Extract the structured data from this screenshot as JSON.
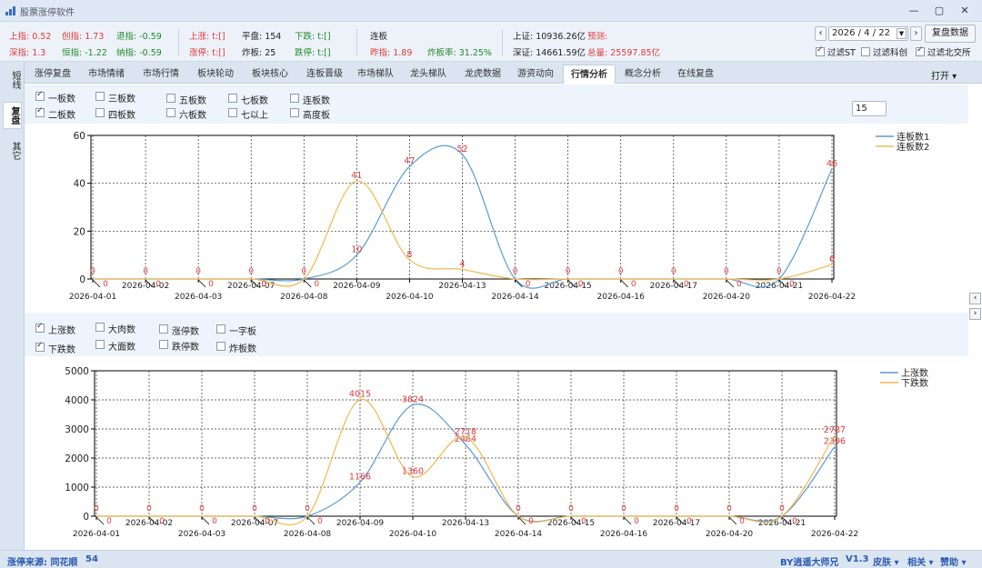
{
  "window": {
    "title": "股票涨停软件"
  },
  "info": {
    "shang_zhi": "上指: 0.52",
    "chuang_zhi": "创指: 1.73",
    "tui_zhi": "退指: -0.59",
    "shen_zhi": "深指: 1.3",
    "heng_zhi": "恒指: -1.22",
    "na_zhi": "纳指: -0.59",
    "shang_zhang": "上涨: t:[]",
    "ping_pan": "平盘: 154",
    "xia_die": "下跌: t:[]",
    "zhang_ting": "涨停: t:[]",
    "zha_ban": "炸板: 25",
    "die_ting": "跌停: t:[]",
    "lian_ban": "连板",
    "zuo_zhi": "昨指: 1.89",
    "zha_ban_lv": "炸板率: 31.25%",
    "shang_zheng": "上证: 10936.26亿",
    "yu_ce": "预测:",
    "shen_zheng": "深证: 14661.59亿",
    "zong_liang": "总量: 25597.85亿"
  },
  "controls": {
    "date": "2026 / 4 / 22",
    "replay_button": "复盘数据",
    "filter_st": "过滤ST",
    "filter_kc": "过滤科创",
    "filter_bj": "过滤北交所"
  },
  "side_tabs": [
    "短线",
    "复盘",
    "其它"
  ],
  "tabs": [
    "涨停复盘",
    "市场情绪",
    "市场行情",
    "板块轮动",
    "板块核心",
    "连板晋级",
    "市场梯队",
    "龙头梯队",
    "龙虎数据",
    "游资动向",
    "行情分析",
    "概念分析",
    "在线复盘"
  ],
  "open_button": "打开",
  "top_options": [
    {
      "label": "一板数",
      "checked": true
    },
    {
      "label": "二板数",
      "checked": true
    },
    {
      "label": "三板数",
      "checked": false
    },
    {
      "label": "四板数",
      "checked": false
    },
    {
      "label": "五板数",
      "checked": false
    },
    {
      "label": "六板数",
      "checked": false
    },
    {
      "label": "七板数",
      "checked": false
    },
    {
      "label": "七以上",
      "checked": false
    },
    {
      "label": "连板数",
      "checked": false
    },
    {
      "label": "高度板",
      "checked": false
    }
  ],
  "days_input": "15",
  "bottom_options": [
    {
      "label": "上涨数",
      "checked": true
    },
    {
      "label": "下跌数",
      "checked": true
    },
    {
      "label": "大肉数",
      "checked": false
    },
    {
      "label": "大面数",
      "checked": false
    },
    {
      "label": "涨停数",
      "checked": false
    },
    {
      "label": "跌停数",
      "checked": false
    },
    {
      "label": "一字板",
      "checked": false
    },
    {
      "label": "炸板数",
      "checked": false
    }
  ],
  "status": {
    "source": "涨停来源: 同花顺",
    "count": "54",
    "author": "BY逍遥大师兄",
    "version": "V1.3",
    "skin": "皮肤",
    "related": "相关",
    "donate": "赞助"
  },
  "colors": {
    "series1": "#5b9bd5",
    "series2": "#f0b850",
    "label": "#e03a3a",
    "text_red": "#e03a3a",
    "text_green": "#1f8a2a"
  },
  "chart_data": [
    {
      "type": "line",
      "categories": [
        "2026-04-01",
        "2026-04-02",
        "2026-04-03",
        "2026-04-07",
        "2026-04-08",
        "2026-04-09",
        "2026-04-10",
        "2026-04-13",
        "2026-04-14",
        "2026-04-15",
        "2026-04-16",
        "2026-04-17",
        "2026-04-20",
        "2026-04-21",
        "2026-04-22"
      ],
      "series": [
        {
          "name": "连板数1",
          "values": [
            0,
            0,
            0,
            0,
            0,
            10,
            47,
            52,
            0,
            0,
            0,
            0,
            0,
            0,
            46
          ],
          "color": "#5b9bd5"
        },
        {
          "name": "连板数2",
          "values": [
            0,
            0,
            0,
            0,
            0,
            41,
            8,
            4,
            0,
            0,
            0,
            0,
            0,
            0,
            6
          ],
          "color": "#f0b850"
        }
      ],
      "ylim": [
        0,
        60
      ],
      "yticks": [
        0,
        20,
        40,
        60
      ],
      "grid": true,
      "legend": "top-right"
    },
    {
      "type": "line",
      "categories": [
        "2026-04-01",
        "2026-04-02",
        "2026-04-03",
        "2026-04-07",
        "2026-04-08",
        "2026-04-09",
        "2026-04-10",
        "2026-04-13",
        "2026-04-14",
        "2026-04-15",
        "2026-04-16",
        "2026-04-17",
        "2026-04-20",
        "2026-04-21",
        "2026-04-22"
      ],
      "series": [
        {
          "name": "上涨数",
          "values": [
            0,
            0,
            0,
            0,
            0,
            1166,
            3824,
            2464,
            0,
            0,
            0,
            0,
            0,
            0,
            2396
          ],
          "color": "#5b9bd5"
        },
        {
          "name": "下跌数",
          "values": [
            0,
            0,
            0,
            0,
            0,
            4015,
            1360,
            2718,
            0,
            0,
            0,
            0,
            0,
            0,
            2787
          ],
          "color": "#f0b850"
        }
      ],
      "ylim": [
        0,
        5000
      ],
      "yticks": [
        0,
        1000,
        2000,
        3000,
        4000,
        5000
      ],
      "grid": true,
      "legend": "top-right"
    }
  ]
}
